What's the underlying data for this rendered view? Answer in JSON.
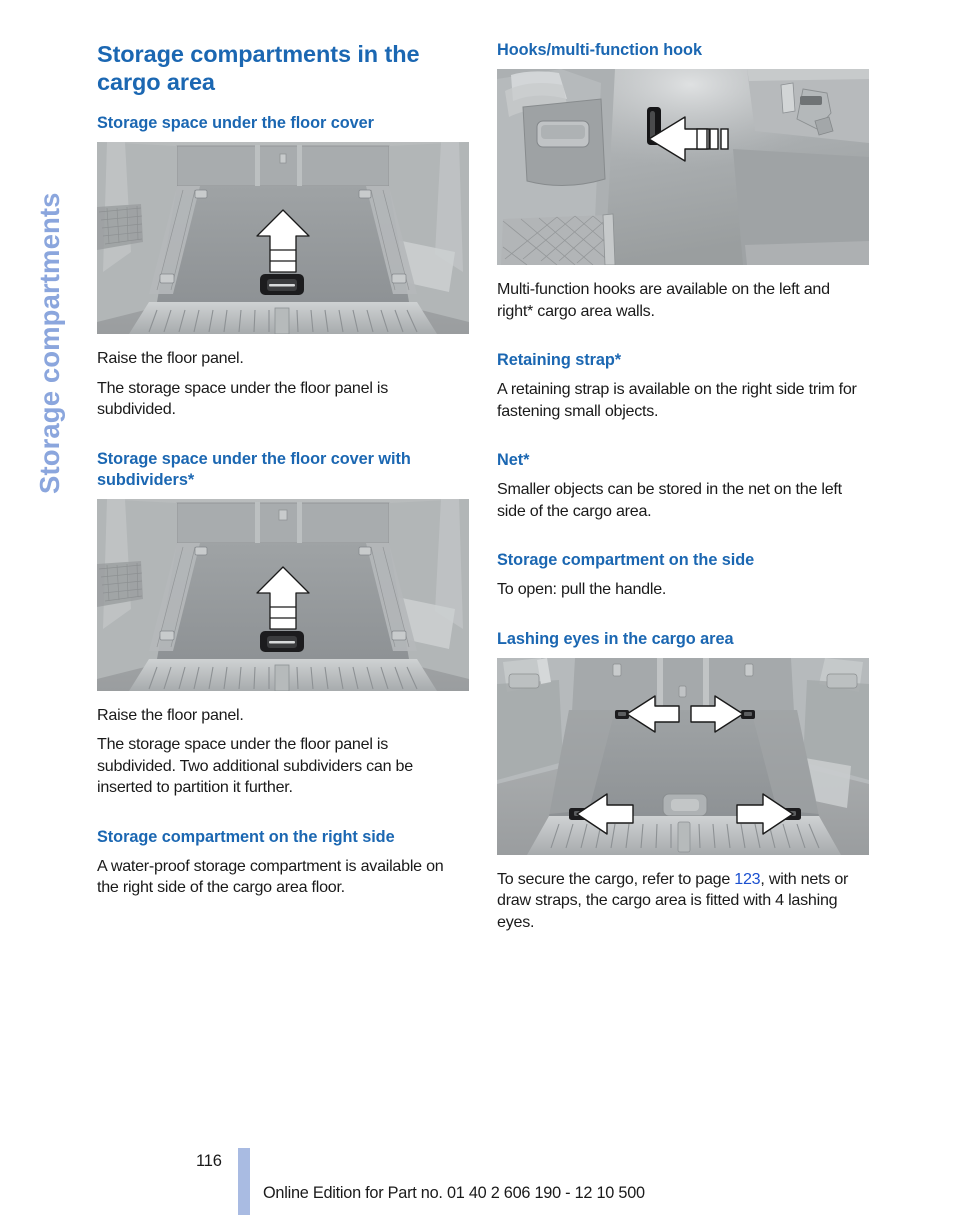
{
  "sidebar": {
    "chapter_title": "Storage compartments",
    "color": "#8ba6dd"
  },
  "accent_color": "#1b67b2",
  "link_color": "#1b50d0",
  "left_column": {
    "title": "Storage compartments in the cargo area",
    "section1": {
      "heading": "Storage space under the floor cover",
      "figure_name": "cargo-floor-cover-arrow-up",
      "paragraphs": [
        "Raise the floor panel.",
        "The storage space under the floor panel is subdivided."
      ]
    },
    "section2": {
      "heading": "Storage space under the floor cover with subdividers*",
      "figure_name": "cargo-floor-cover-subdividers-arrow-up",
      "paragraphs": [
        "Raise the floor panel.",
        "The storage space under the floor panel is subdivided. Two additional subdividers can be inserted to partition it further."
      ]
    },
    "section3": {
      "heading": "Storage compartment on the right side",
      "paragraphs": [
        "A water-proof storage compartment is available on the right side of the cargo area floor."
      ]
    }
  },
  "right_column": {
    "section1": {
      "heading": "Hooks/multi-function hook",
      "figure_name": "cargo-wall-multifunction-hook-arrow-left",
      "paragraphs": [
        "Multi-function hooks are available on the left and right* cargo area walls."
      ]
    },
    "section2": {
      "heading": "Retaining strap*",
      "paragraphs": [
        "A retaining strap is available on the right side trim for fastening small objects."
      ]
    },
    "section3": {
      "heading": "Net*",
      "paragraphs": [
        "Smaller objects can be stored in the net on the left side of the cargo area."
      ]
    },
    "section4": {
      "heading": "Storage compartment on the side",
      "paragraphs": [
        "To open: pull the handle."
      ]
    },
    "section5": {
      "heading": "Lashing eyes in the cargo area",
      "figure_name": "cargo-lashing-eyes-four-arrows",
      "paragraph_before_link": "To secure the cargo, refer to page ",
      "link_text": "123",
      "paragraph_after_link": ", with nets or draw straps, the cargo area is fitted with 4 lashing eyes."
    }
  },
  "footer": {
    "page_number": "116",
    "text": "Online Edition for Part no. 01 40 2 606 190 - 12 10 500",
    "bar_color": "#a9bbe2"
  }
}
